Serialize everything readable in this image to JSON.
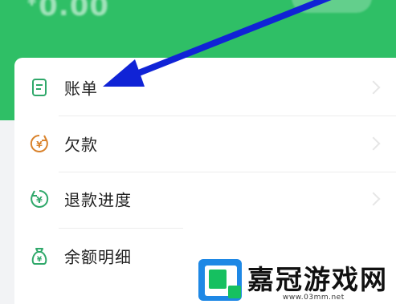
{
  "header": {
    "balance_symbol": "¥",
    "balance_value": "0.00"
  },
  "colors": {
    "header_green": "#2fbf66",
    "icon_green": "#2fa86a",
    "icon_orange": "#d9822b",
    "arrow_blue": "#1023d6"
  },
  "menu": {
    "items": [
      {
        "label": "账单",
        "icon": "bill-icon"
      },
      {
        "label": "欠款",
        "icon": "debt-icon"
      },
      {
        "label": "退款进度",
        "icon": "refund-icon"
      },
      {
        "label": "余额明细",
        "icon": "money-bag-icon"
      }
    ]
  },
  "watermark": {
    "title": "嘉冠游戏网",
    "url": "www.03mm.net"
  }
}
